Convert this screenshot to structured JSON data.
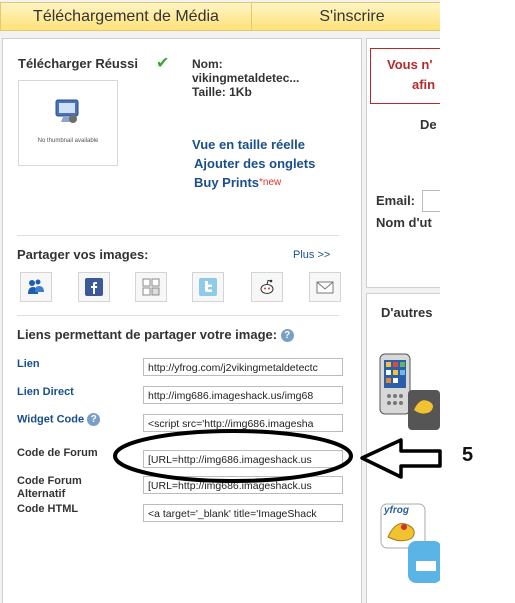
{
  "tabs": {
    "upload": "Téléchargement de Média",
    "signup": "S'inscrire"
  },
  "upload": {
    "title": "Télécharger Réussi",
    "thumb_caption": "No thumbnail available",
    "name_label": "Nom:",
    "name_value": "vikingmetaldetec...",
    "size_label": "Taille: 1Kb",
    "link_fullsize": "Vue en taille réelle",
    "link_tabs": "Ajouter des onglets",
    "link_prints": "Buy Prints",
    "new_badge": "*new"
  },
  "share": {
    "title": "Partager vos images:",
    "more": "Plus >>",
    "icons": [
      "myspace-icon",
      "facebook-icon",
      "digg-icon",
      "twitter-icon",
      "reddit-icon",
      "email-icon"
    ]
  },
  "share_links": {
    "title": "Liens permettant de partager votre image:",
    "help": "?",
    "rows": [
      {
        "label": "Lien",
        "value": "http://yfrog.com/j2vikingmetaldetectc"
      },
      {
        "label": "Lien Direct",
        "value": "http://img686.imageshack.us/img68"
      },
      {
        "label": "Widget Code",
        "value": "<script src='http://img686.imagesha"
      },
      {
        "label": "Code de Forum",
        "value": "[URL=http://img686.imageshack.us"
      },
      {
        "label": "Code Forum Alternatif",
        "value": "[URL=http://img686.imageshack.us"
      },
      {
        "label": "Code HTML",
        "value": "<a target='_blank' title='ImageShack"
      }
    ]
  },
  "right": {
    "notice_line1": "Vous n'",
    "notice_line2": "afin",
    "de": "De",
    "email_label": "Email:",
    "username_label": "Nom d'ut",
    "others_title": "D'autres",
    "yfrog": "yfrog"
  },
  "annotation": {
    "number": "5"
  }
}
